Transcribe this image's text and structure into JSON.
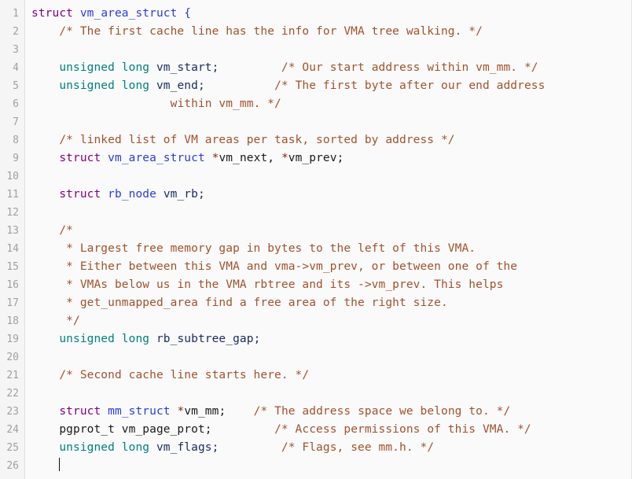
{
  "editor": {
    "language": "c",
    "theme_background": "#fafafa",
    "gutter_background": "#f5f5f5",
    "gutter_text_color": "#a0a0a0",
    "total_lines": 26,
    "cursor": {
      "line": 26,
      "column": 5,
      "visible": true
    },
    "colors": {
      "keyword": "#008080",
      "struct_keyword": "#800080",
      "type_name": "#2b3be0",
      "identifier": "#1a1a1a",
      "variable": "#1a2b5e",
      "comment": "#a0522d",
      "pointer_star": "#8b2500",
      "brace": "#2b3be0"
    }
  },
  "line_numbers": [
    "1",
    "2",
    "3",
    "4",
    "5",
    "6",
    "7",
    "8",
    "9",
    "10",
    "11",
    "12",
    "13",
    "14",
    "15",
    "16",
    "17",
    "18",
    "19",
    "20",
    "21",
    "22",
    "23",
    "24",
    "25",
    "26"
  ],
  "code": {
    "plain_text": "struct vm_area_struct {\n    /* The first cache line has the info for VMA tree walking. */\n\n    unsigned long vm_start;         /* Our start address within vm_mm. */\n    unsigned long vm_end;          /* The first byte after our end address\n                    within vm_mm. */\n\n    /* linked list of VM areas per task, sorted by address */\n    struct vm_area_struct *vm_next, *vm_prev;\n\n    struct rb_node vm_rb;\n\n    /*\n     * Largest free memory gap in bytes to the left of this VMA.\n     * Either between this VMA and vma->vm_prev, or between one of the\n     * VMAs below us in the VMA rbtree and its ->vm_prev. This helps\n     * get_unmapped_area find a free area of the right size.\n     */\n    unsigned long rb_subtree_gap;\n\n    /* Second cache line starts here. */\n\n    struct mm_struct *vm_mm;    /* The address space we belong to. */\n    pgprot_t vm_page_prot;         /* Access permissions of this VMA. */\n    unsigned long vm_flags;         /* Flags, see mm.h. */\n",
    "lines": [
      {
        "n": 1,
        "tokens": [
          {
            "t": "struct",
            "c": "t-struct"
          },
          {
            "t": " ",
            "c": "t-punct"
          },
          {
            "t": "vm_area_struct",
            "c": "t-type"
          },
          {
            "t": " ",
            "c": "t-punct"
          },
          {
            "t": "{",
            "c": "t-brace"
          }
        ]
      },
      {
        "n": 2,
        "tokens": [
          {
            "t": "    ",
            "c": "t-punct"
          },
          {
            "t": "/* The first cache line has the info for VMA tree walking. */",
            "c": "t-comment"
          }
        ]
      },
      {
        "n": 3,
        "tokens": []
      },
      {
        "n": 4,
        "tokens": [
          {
            "t": "    ",
            "c": "t-punct"
          },
          {
            "t": "unsigned long",
            "c": "t-kw"
          },
          {
            "t": " ",
            "c": "t-punct"
          },
          {
            "t": "vm_start;",
            "c": "t-var"
          },
          {
            "t": "         ",
            "c": "t-punct"
          },
          {
            "t": "/* Our start address within vm_mm. */",
            "c": "t-comment"
          }
        ]
      },
      {
        "n": 5,
        "tokens": [
          {
            "t": "    ",
            "c": "t-punct"
          },
          {
            "t": "unsigned long",
            "c": "t-kw"
          },
          {
            "t": " ",
            "c": "t-punct"
          },
          {
            "t": "vm_end;",
            "c": "t-var"
          },
          {
            "t": "          ",
            "c": "t-punct"
          },
          {
            "t": "/* The first byte after our end address",
            "c": "t-comment"
          }
        ]
      },
      {
        "n": 6,
        "tokens": [
          {
            "t": "                    ",
            "c": "t-punct"
          },
          {
            "t": "within vm_mm. */",
            "c": "t-comment"
          }
        ]
      },
      {
        "n": 7,
        "tokens": []
      },
      {
        "n": 8,
        "tokens": [
          {
            "t": "    ",
            "c": "t-punct"
          },
          {
            "t": "/* linked list of VM areas per task, sorted by address */",
            "c": "t-comment"
          }
        ]
      },
      {
        "n": 9,
        "tokens": [
          {
            "t": "    ",
            "c": "t-punct"
          },
          {
            "t": "struct",
            "c": "t-struct"
          },
          {
            "t": " ",
            "c": "t-punct"
          },
          {
            "t": "vm_area_struct",
            "c": "t-type"
          },
          {
            "t": " ",
            "c": "t-punct"
          },
          {
            "t": "*",
            "c": "t-star"
          },
          {
            "t": "vm_next, ",
            "c": "t-ident"
          },
          {
            "t": "*",
            "c": "t-star"
          },
          {
            "t": "vm_prev;",
            "c": "t-ident"
          }
        ]
      },
      {
        "n": 10,
        "tokens": []
      },
      {
        "n": 11,
        "tokens": [
          {
            "t": "    ",
            "c": "t-punct"
          },
          {
            "t": "struct",
            "c": "t-struct"
          },
          {
            "t": " ",
            "c": "t-punct"
          },
          {
            "t": "rb_node",
            "c": "t-type"
          },
          {
            "t": " ",
            "c": "t-punct"
          },
          {
            "t": "vm_rb;",
            "c": "t-var"
          }
        ]
      },
      {
        "n": 12,
        "tokens": []
      },
      {
        "n": 13,
        "tokens": [
          {
            "t": "    ",
            "c": "t-punct"
          },
          {
            "t": "/*",
            "c": "t-comment"
          }
        ]
      },
      {
        "n": 14,
        "tokens": [
          {
            "t": "     ",
            "c": "t-punct"
          },
          {
            "t": "* Largest free memory gap in bytes to the left of this VMA.",
            "c": "t-comment"
          }
        ]
      },
      {
        "n": 15,
        "tokens": [
          {
            "t": "     ",
            "c": "t-punct"
          },
          {
            "t": "* Either between this VMA and vma->vm_prev, or between one of the",
            "c": "t-comment"
          }
        ]
      },
      {
        "n": 16,
        "tokens": [
          {
            "t": "     ",
            "c": "t-punct"
          },
          {
            "t": "* VMAs below us in the VMA rbtree and its ->vm_prev. This helps",
            "c": "t-comment"
          }
        ]
      },
      {
        "n": 17,
        "tokens": [
          {
            "t": "     ",
            "c": "t-punct"
          },
          {
            "t": "* get_unmapped_area find a free area of the right size.",
            "c": "t-comment"
          }
        ]
      },
      {
        "n": 18,
        "tokens": [
          {
            "t": "     ",
            "c": "t-punct"
          },
          {
            "t": "*/",
            "c": "t-comment"
          }
        ]
      },
      {
        "n": 19,
        "tokens": [
          {
            "t": "    ",
            "c": "t-punct"
          },
          {
            "t": "unsigned long",
            "c": "t-kw"
          },
          {
            "t": " ",
            "c": "t-punct"
          },
          {
            "t": "rb_subtree_gap;",
            "c": "t-var"
          }
        ]
      },
      {
        "n": 20,
        "tokens": []
      },
      {
        "n": 21,
        "tokens": [
          {
            "t": "    ",
            "c": "t-punct"
          },
          {
            "t": "/* Second cache line starts here. */",
            "c": "t-comment"
          }
        ]
      },
      {
        "n": 22,
        "tokens": []
      },
      {
        "n": 23,
        "tokens": [
          {
            "t": "    ",
            "c": "t-punct"
          },
          {
            "t": "struct",
            "c": "t-struct"
          },
          {
            "t": " ",
            "c": "t-punct"
          },
          {
            "t": "mm_struct",
            "c": "t-type"
          },
          {
            "t": " ",
            "c": "t-punct"
          },
          {
            "t": "*",
            "c": "t-star"
          },
          {
            "t": "vm_mm;",
            "c": "t-ident"
          },
          {
            "t": "    ",
            "c": "t-punct"
          },
          {
            "t": "/* The address space we belong to. */",
            "c": "t-comment"
          }
        ]
      },
      {
        "n": 24,
        "tokens": [
          {
            "t": "    ",
            "c": "t-punct"
          },
          {
            "t": "pgprot_t vm_page_prot;",
            "c": "t-ident"
          },
          {
            "t": "         ",
            "c": "t-punct"
          },
          {
            "t": "/* Access permissions of this VMA. */",
            "c": "t-comment"
          }
        ]
      },
      {
        "n": 25,
        "tokens": [
          {
            "t": "    ",
            "c": "t-punct"
          },
          {
            "t": "unsigned long",
            "c": "t-kw"
          },
          {
            "t": " ",
            "c": "t-punct"
          },
          {
            "t": "vm_flags;",
            "c": "t-var"
          },
          {
            "t": "         ",
            "c": "t-punct"
          },
          {
            "t": "/* Flags, see mm.h. */",
            "c": "t-comment"
          }
        ]
      },
      {
        "n": 26,
        "tokens": [
          {
            "t": "    ",
            "c": "t-punct"
          }
        ],
        "caret": true
      }
    ]
  }
}
